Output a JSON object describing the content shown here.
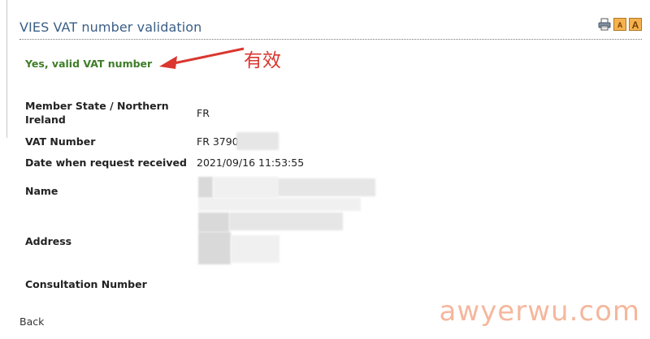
{
  "header": {
    "title": "VIES VAT number validation",
    "toolbar": {
      "icons": [
        "print-icon",
        "font-size-icon",
        "font-size-large-icon"
      ],
      "font_icon_letter": "A"
    }
  },
  "result": {
    "status_text": "Yes, valid VAT number",
    "annotation_text": "有效",
    "annotation_color": "#d9372f"
  },
  "details": {
    "member_state_label": "Member State / Northern Ireland",
    "member_state_value": "FR",
    "vat_number_label": "VAT Number",
    "vat_number_value": "FR 3790",
    "date_label": "Date when request received",
    "date_value": "2021/09/16 11:53:55",
    "name_label": "Name",
    "address_label": "Address",
    "consultation_label": "Consultation Number"
  },
  "footer": {
    "back_label": "Back"
  },
  "watermark": {
    "text": "awyerwu.com"
  },
  "colors": {
    "title": "#3a5f86",
    "status": "#3e7d27",
    "annotation": "#d9372f",
    "watermark": "#f2a07d"
  }
}
